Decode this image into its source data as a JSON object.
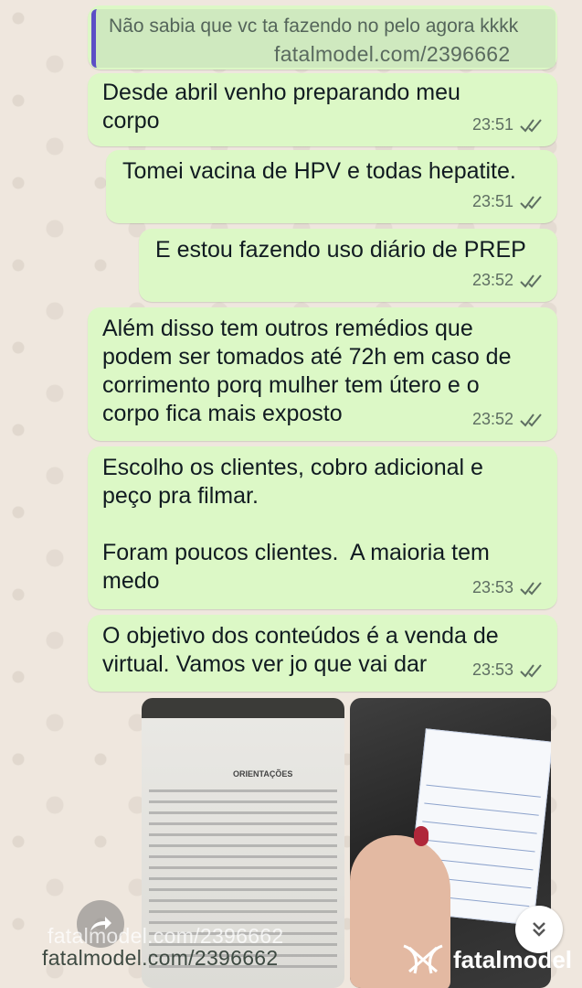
{
  "quoted_message": {
    "text": "Não sabia que vc ta fazendo no pelo agora kkkk"
  },
  "watermark": {
    "url": "fatalmodel.com/2396662",
    "brand": "fatalmodel"
  },
  "messages": [
    {
      "text": "Desde abril venho preparando meu\ncorpo",
      "time": "23:51",
      "status": "read"
    },
    {
      "text": "Tomei vacina de HPV e todas hepatite.",
      "time": "23:51",
      "status": "read"
    },
    {
      "text": "E estou fazendo uso diário de PREP",
      "time": "23:52",
      "status": "read"
    },
    {
      "text": "Além disso tem outros remédios que\npodem ser tomados até 72h em caso de\ncorrimento porq mulher tem útero e o\ncorpo fica mais exposto",
      "time": "23:52",
      "status": "read"
    },
    {
      "text": "Escolho os clientes, cobro adicional e\npeço pra filmar.\n\nForam poucos clientes.  A maioria tem\nmedo",
      "time": "23:53",
      "status": "read"
    },
    {
      "text": "O objetivo dos conteúdos é a venda de\nvirtual. Vamos ver jo que vai dar",
      "time": "23:53",
      "status": "read"
    }
  ],
  "media": [
    {
      "type": "photo",
      "subject": "medical-document",
      "visible_text": "ORIENTAÇÕES"
    },
    {
      "type": "photo",
      "subject": "vaccination-card"
    }
  ],
  "icons": {
    "read_receipt": "double-check-icon",
    "forward": "forward-icon",
    "scroll_down": "chevron-double-down-icon"
  },
  "colors": {
    "outgoing_bubble": "#dcf8c6",
    "quote_bar": "#5c4fc6",
    "background": "#efe7de"
  }
}
